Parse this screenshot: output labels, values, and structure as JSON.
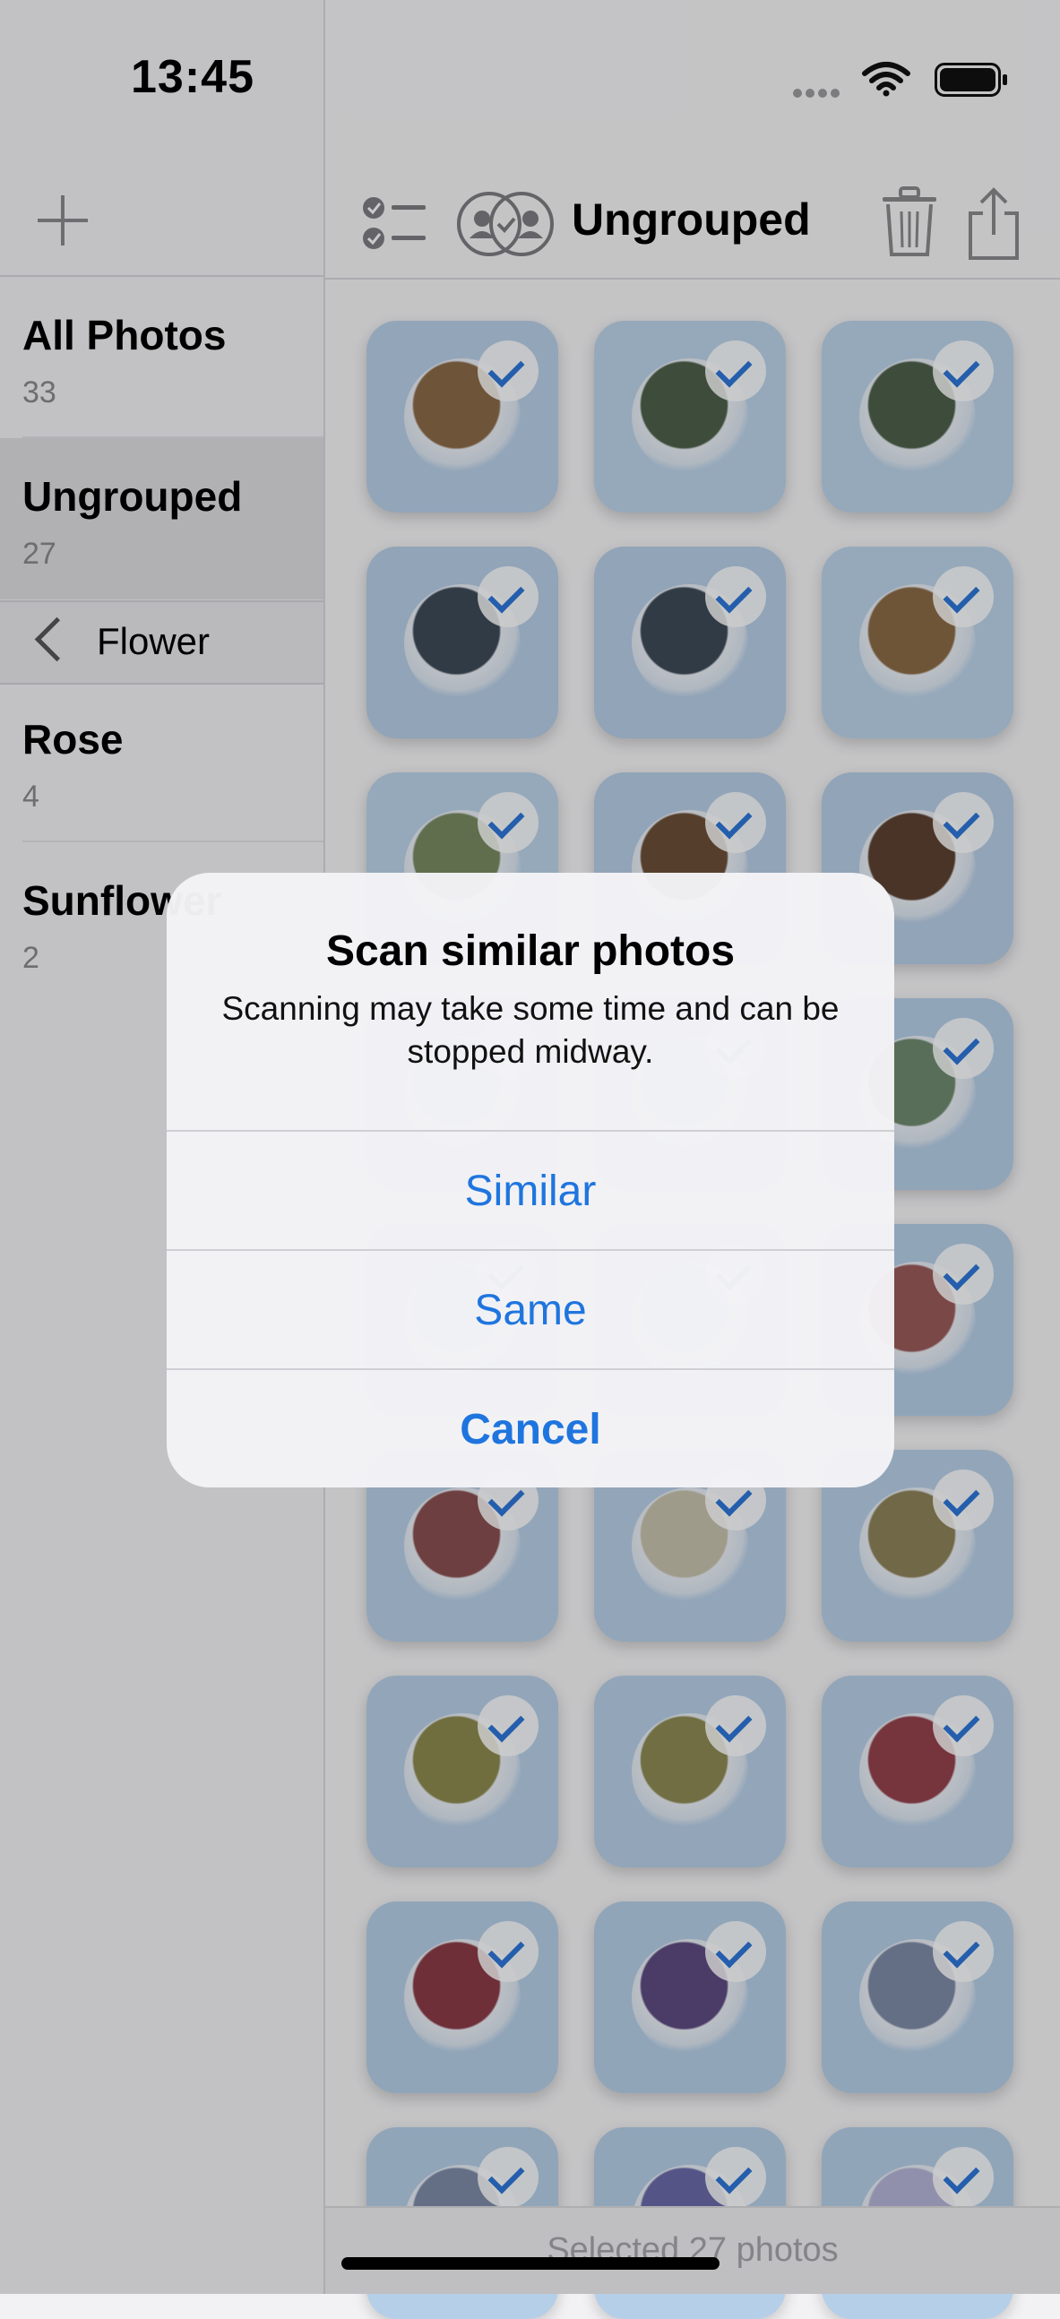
{
  "status": {
    "time": "13:45"
  },
  "sidebar": {
    "items": [
      {
        "title": "All Photos",
        "count": "33"
      },
      {
        "title": "Ungrouped",
        "count": "27"
      }
    ],
    "back": {
      "label": "Flower"
    },
    "subitems": [
      {
        "title": "Rose",
        "count": "4"
      },
      {
        "title": "Sunflower",
        "count": "2"
      }
    ]
  },
  "toolbar": {
    "title": "Ungrouped"
  },
  "photos": [
    {
      "bg": "#b8cfe8",
      "plate": "#8a6a48"
    },
    {
      "bg": "#bcd4ea",
      "plate": "#4d5f4a"
    },
    {
      "bg": "#bcd4ea",
      "plate": "#4d5f4a"
    },
    {
      "bg": "#b6cde6",
      "plate": "#3e4a58"
    },
    {
      "bg": "#b6cde6",
      "plate": "#3e4a58"
    },
    {
      "bg": "#bcd4ea",
      "plate": "#8b6b47"
    },
    {
      "bg": "#bcd4ea",
      "plate": "#7a8a62"
    },
    {
      "bg": "#b7cde6",
      "plate": "#6b4f37"
    },
    {
      "bg": "#b7cde6",
      "plate": "#5c4231"
    },
    {
      "bg": "#b7cde6",
      "plate": "#a8c1df"
    },
    {
      "bg": "#b7cde6",
      "plate": "#a8c1df"
    },
    {
      "bg": "#b6cfe8",
      "plate": "#6f8a6f"
    },
    {
      "bg": "#b6cfe8",
      "plate": "#a8c1df"
    },
    {
      "bg": "#b6cfe8",
      "plate": "#a8c1df"
    },
    {
      "bg": "#b6cfe8",
      "plate": "#9a5b5b"
    },
    {
      "bg": "#b8d0e8",
      "plate": "#8a4f50"
    },
    {
      "bg": "#b8d0e8",
      "plate": "#c7c2ad"
    },
    {
      "bg": "#b8d0e8",
      "plate": "#8d8358"
    },
    {
      "bg": "#b8d0e8",
      "plate": "#8c8a4e"
    },
    {
      "bg": "#b8d0e8",
      "plate": "#8d8a53"
    },
    {
      "bg": "#b8d0e8",
      "plate": "#94414c"
    },
    {
      "bg": "#b6cfe8",
      "plate": "#8a3b46"
    },
    {
      "bg": "#b6cfe8",
      "plate": "#5d4b81"
    },
    {
      "bg": "#b6cfe8",
      "plate": "#7d8aa7"
    },
    {
      "bg": "#b6cfe8",
      "plate": "#7d8aa7"
    },
    {
      "bg": "#b6cfe8",
      "plate": "#6b6aa8"
    },
    {
      "bg": "#b6cfe8",
      "plate": "#b6b5d7"
    }
  ],
  "footer": {
    "text": "Selected 27 photos"
  },
  "alert": {
    "title": "Scan similar photos",
    "message": "Scanning may take some time and can be stopped midway.",
    "buttons": [
      "Similar",
      "Same",
      "Cancel"
    ]
  },
  "colors": {
    "accent": "#1f75de",
    "overlay": "rgba(0,0,0,0.20)"
  }
}
